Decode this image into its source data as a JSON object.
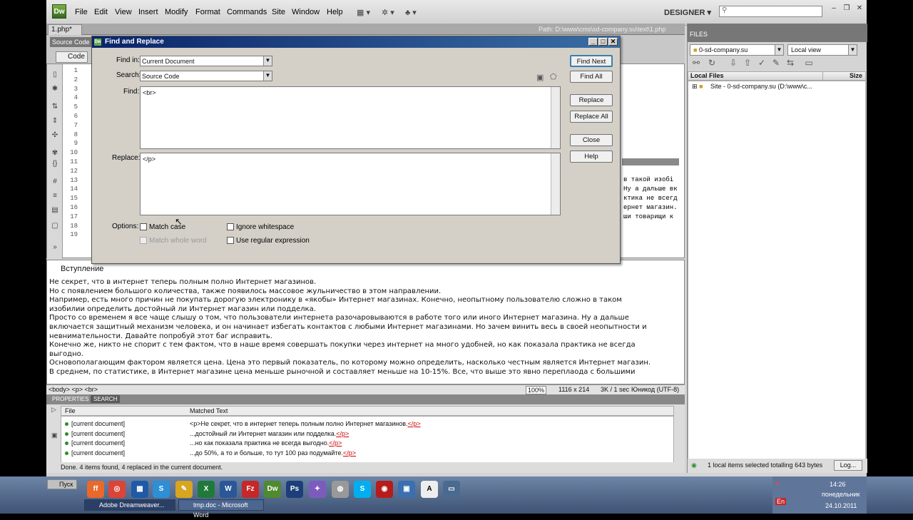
{
  "menubar": {
    "logo": "Dw",
    "items": [
      "File",
      "Edit",
      "View",
      "Insert",
      "Modify",
      "Format",
      "Commands",
      "Site",
      "Window",
      "Help"
    ],
    "workspace": "DESIGNER",
    "search_placeholder": ""
  },
  "document": {
    "tab": "1.php*",
    "path": "Path:  D:\\www\\cms\\sd-company.su\\text\\1.php",
    "source_code_tab": "Source Code",
    "code_button": "Code",
    "line_numbers": [
      "1",
      "2",
      "3",
      "4",
      "5",
      "6",
      "7",
      "8",
      "9",
      "10",
      "11",
      "12",
      "13",
      "14",
      "15",
      "16",
      "17",
      "18",
      "19"
    ],
    "code_lines_right": [
      "в такой изобі",
      "Ну а дальше вк",
      "ктика не всегд",
      "ернет магазин.",
      "ши товарищи к"
    ]
  },
  "design": {
    "heading": "Вступление",
    "paragraphs": [
      "    Не секрет, что в интернет теперь полным полно Интернет магазинов.",
      "Но с появлением большого количества, также появилось массовое жульничество в этом направлении.",
      "Например, есть много причин не покупать дорогую электронику в «якобы» Интернет магазинах. Конечно, неопытному пользователю сложно в таком",
      "изобилии определить достойный ли Интернет магазин или подделка.",
      "Просто со временем я все чаще слышу о том, что пользователи интернета разочаровываются в работе того или иного Интернет магазина. Ну а дальше",
      "включается защитный механизм человека, и он начинает избегать контактов с любыми Интернет магазинами. Но зачем винить весь в своей неопытности и",
      "невнимательности. Давайте попробуй этот баг исправить.",
      "Конечно же, никто не спорит с тем фактом, что в наше время совершать покупки через интернет на много удобней, но как показала практика не всегда",
      "выгодно.",
      "Основополагающим фактором является цена. Цена это первый показатель, по которому можно определить, насколько честным является Интернет магазин.",
      "В среднем, по статистике, в Интернет магазине цена меньше рыночной и составляет меньше на 10-15%. Все, что выше это явно переплаода с большими"
    ]
  },
  "statusbar": {
    "tags": "<body> <p> <br>",
    "zoom": "100%",
    "size": "1116 x 214",
    "weight": "3K / 1 sec",
    "encoding": "Юникод (UTF-8)"
  },
  "panels": {
    "tabs": [
      "PROPERTIES",
      "SEARCH"
    ],
    "col_file": "File",
    "col_matched": "Matched Text",
    "results": [
      {
        "file": "[current document]",
        "pre": "<p>Не секрет, что в интернет теперь полным полно Интернет магазинов.",
        "tag": "</p>"
      },
      {
        "file": "[current document]",
        "pre": "...достойный ли Интернет магазин или подделка.",
        "tag": "</p>"
      },
      {
        "file": "[current document]",
        "pre": "...но как показала практика не всегда выгодно.",
        "tag": "</p>"
      },
      {
        "file": "[current document]",
        "pre": "...до 50%, а то и больше, то тут 100 раз подумайте.",
        "tag": "</p>"
      }
    ],
    "status": "Done.  4 items found,  4 replaced in the current document."
  },
  "files": {
    "title": "FILES",
    "site": "0-sd-company.su",
    "view": "Local view",
    "col_local": "Local Files",
    "col_size": "Size",
    "tree_item": "Site - 0-sd-company.su (D:\\www\\c...",
    "status": "1 local items selected totalling 643 bytes",
    "log": "Log..."
  },
  "dialog": {
    "title": "Find and Replace",
    "find_in_label": "Find in:",
    "find_in_value": "Current Document",
    "search_label": "Search:",
    "search_value": "Source Code",
    "find_label": "Find:",
    "find_value": "<br>",
    "replace_label": "Replace:",
    "replace_value": "</p>",
    "options_label": "Options:",
    "match_case": "Match case",
    "match_whole_word": "Match whole word",
    "ignore_whitespace": "Ignore whitespace",
    "use_regex": "Use regular expression",
    "buttons": {
      "find_next": "Find Next",
      "find_all": "Find All",
      "replace": "Replace",
      "replace_all": "Replace All",
      "close": "Close",
      "help": "Help"
    }
  },
  "taskbar": {
    "start": "Пуск",
    "items": [
      "Adobe Dreamweaver...",
      "tmp.doc - Microsoft Word"
    ],
    "time": "14:26",
    "day": "понедельник",
    "date": "24.10.2011",
    "lang": "En"
  }
}
